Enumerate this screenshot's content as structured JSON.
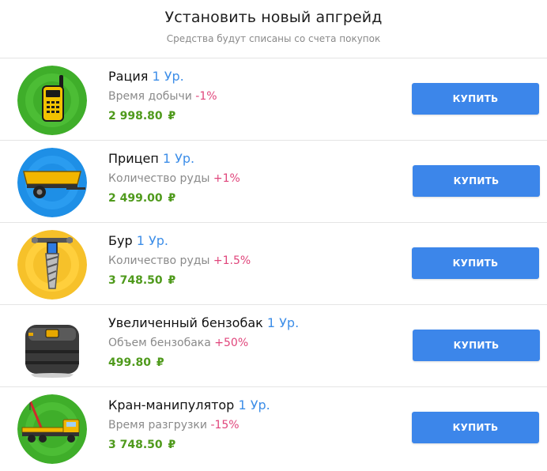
{
  "header": {
    "title": "Установить новый апгрейд",
    "subtitle": "Средства будут списаны со счета покупок"
  },
  "items": [
    {
      "name": "Рация",
      "level": "1 Ур.",
      "stat_label": "Время добычи",
      "delta": "-1%",
      "price": "2 998.80",
      "currency": "₽",
      "buy_label": "КУПИТЬ",
      "icon": "walkie-talkie-icon",
      "icon_bg": "#3fae2a"
    },
    {
      "name": "Прицеп",
      "level": "1 Ур.",
      "stat_label": "Количество руды",
      "delta": "+1%",
      "price": "2 499.00",
      "currency": "₽",
      "buy_label": "КУПИТЬ",
      "icon": "trailer-icon",
      "icon_bg": "#1e8fe6"
    },
    {
      "name": "Бур",
      "level": "1 Ур.",
      "stat_label": "Количество руды",
      "delta": "+1.5%",
      "price": "3 748.50",
      "currency": "₽",
      "buy_label": "КУПИТЬ",
      "icon": "drill-icon",
      "icon_bg": "#f6c12a"
    },
    {
      "name": "Увеличенный бензобак",
      "level": "1 Ур.",
      "stat_label": "Объем бензобака",
      "delta": "+50%",
      "price": "499.80",
      "currency": "₽",
      "buy_label": "КУПИТЬ",
      "icon": "fuel-tank-icon",
      "icon_bg": "#ffffff"
    },
    {
      "name": "Кран-манипулятор",
      "level": "1 Ур.",
      "stat_label": "Время разгрузки",
      "delta": "-15%",
      "price": "3 748.50",
      "currency": "₽",
      "buy_label": "КУПИТЬ",
      "icon": "crane-truck-icon",
      "icon_bg": "#3fae2a"
    }
  ]
}
